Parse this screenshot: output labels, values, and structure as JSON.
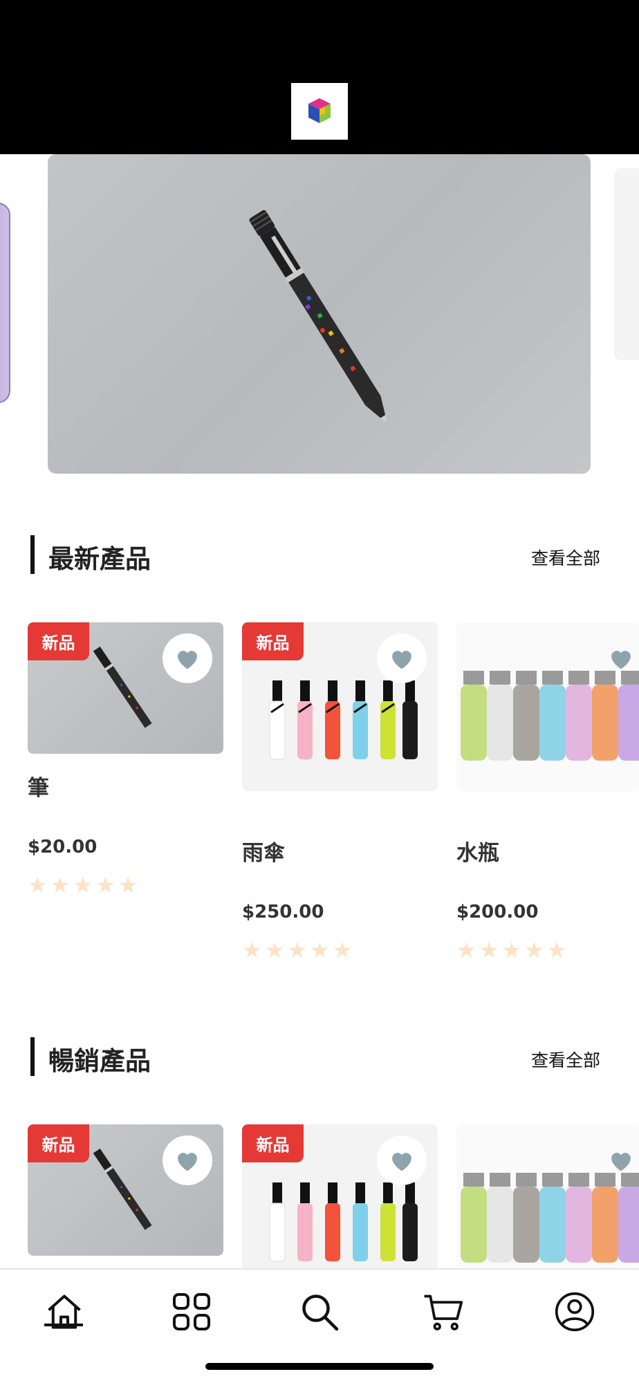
{
  "header": {
    "logo": "cube-logo-icon"
  },
  "banner": {
    "image": "pen-photo",
    "active_index": 1
  },
  "sections": [
    {
      "title": "最新產品",
      "see_all": "查看全部",
      "products": [
        {
          "name": "筆",
          "price": "$20.00",
          "badge": "新品",
          "rating": 0,
          "image": "pen"
        },
        {
          "name": "雨傘",
          "price": "$250.00",
          "badge": "新品",
          "rating": 0,
          "image": "umbrellas"
        },
        {
          "name": "水瓶",
          "price": "$200.00",
          "badge": "",
          "rating": 0,
          "image": "bottles"
        }
      ]
    },
    {
      "title": "暢銷產品",
      "see_all": "查看全部",
      "products": [
        {
          "badge": "新品",
          "image": "pen"
        },
        {
          "badge": "新品",
          "image": "umbrellas"
        },
        {
          "badge": "",
          "image": "bottles"
        }
      ]
    }
  ],
  "nav": {
    "items": [
      {
        "icon": "home-icon",
        "active": true
      },
      {
        "icon": "categories-icon",
        "active": false
      },
      {
        "icon": "search-icon",
        "active": false
      },
      {
        "icon": "cart-icon",
        "active": false
      },
      {
        "icon": "profile-icon",
        "active": false
      }
    ]
  },
  "colors": {
    "badge": "#e53935",
    "heart": "#8fa3ad",
    "star": "#fce3c6",
    "header": "#000000"
  }
}
